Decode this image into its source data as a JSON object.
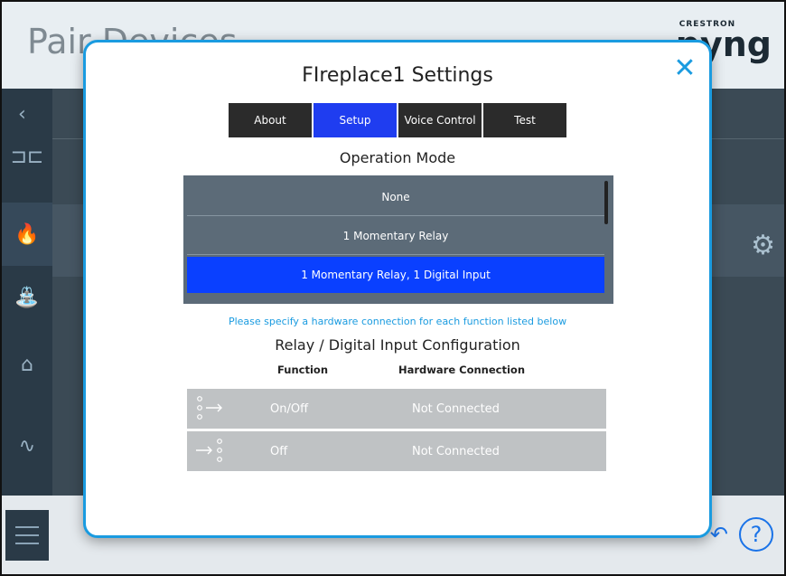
{
  "background": {
    "title": "Pair Devices",
    "logo_small": "CRESTRON",
    "logo_big": "pyng"
  },
  "modal": {
    "title": "FIreplace1 Settings",
    "tabs": [
      {
        "label": "About",
        "active": false
      },
      {
        "label": "Setup",
        "active": true
      },
      {
        "label": "Voice Control",
        "active": false
      },
      {
        "label": "Test",
        "active": false
      }
    ],
    "operation_mode": {
      "title": "Operation Mode",
      "options": [
        "None",
        "1 Momentary Relay",
        "1 Momentary Relay, 1 Digital Input"
      ],
      "selected": "1 Momentary Relay, 1 Digital Input"
    },
    "hint": "Please specify a hardware connection for each function listed below",
    "config": {
      "title": "Relay / Digital Input Configuration",
      "headers": {
        "function": "Function",
        "hardware": "Hardware Connection"
      },
      "rows": [
        {
          "icon": "relay-output-icon",
          "function": "On/Off",
          "hardware": "Not Connected"
        },
        {
          "icon": "digital-input-icon",
          "function": "Off",
          "hardware": "Not Connected"
        }
      ]
    }
  },
  "colors": {
    "accent": "#1a9be0",
    "tab_active": "#1f3df0",
    "selected_option": "#0a40ff",
    "tab_bg": "#2b2b2b"
  }
}
